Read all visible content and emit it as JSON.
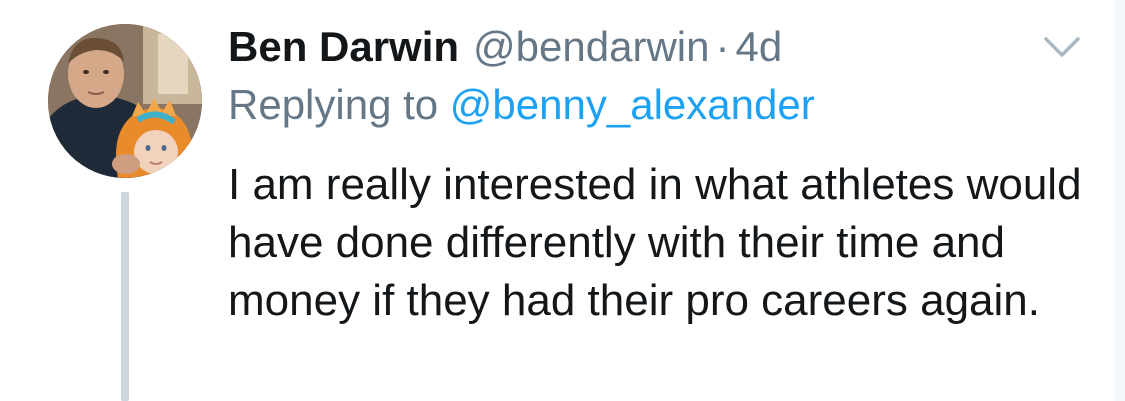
{
  "tweet": {
    "author_name": "Ben Darwin",
    "author_handle": "@bendarwin",
    "separator": "·",
    "timestamp": "4d",
    "replying_prefix": "Replying to",
    "replying_to": "@benny_alexander",
    "text": "I am really interested in what athletes would have done differently with their time and money if they had their pro careers again.",
    "menu_icon": "chevron-down-icon",
    "avatar_icon": "avatar-photo"
  },
  "colors": {
    "text_primary": "#14171a",
    "text_secondary": "#657786",
    "link": "#1da1f2",
    "thread_line": "#ccd6dd"
  }
}
